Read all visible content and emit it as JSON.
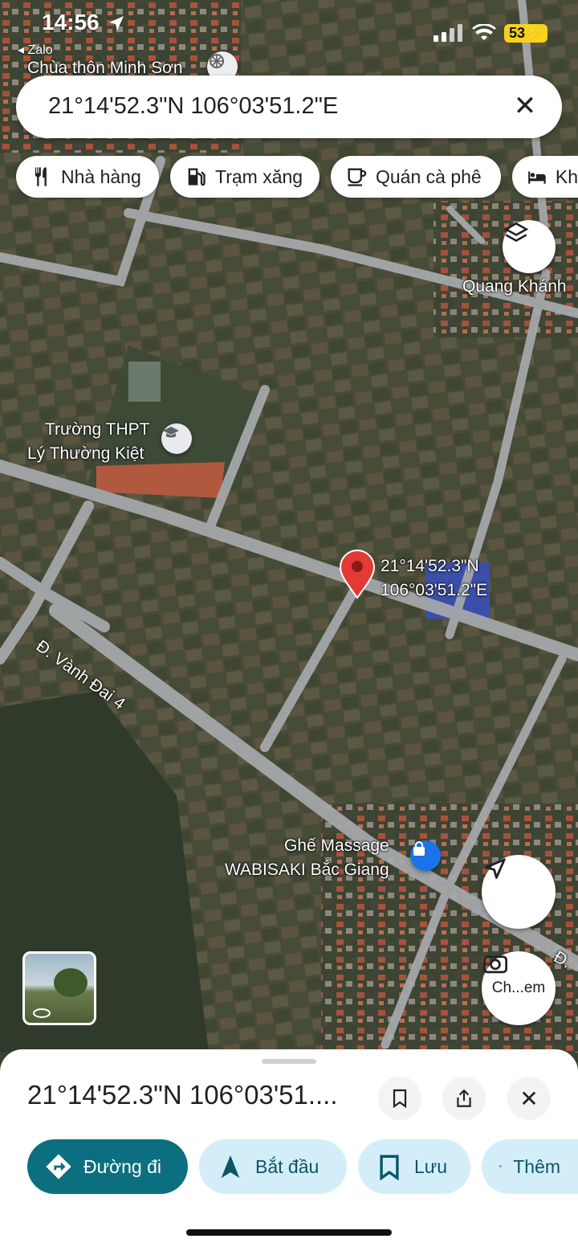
{
  "status_bar": {
    "time": "14:56",
    "back_app": "◂ Zalo",
    "battery": "53"
  },
  "search": {
    "value": "21°14'52.3\"N 106°03'51.2\"E"
  },
  "chips": [
    {
      "label": "Nhà hàng",
      "icon": "restaurant-icon"
    },
    {
      "label": "Trạm xăng",
      "icon": "gas-station-icon"
    },
    {
      "label": "Quán cà phê",
      "icon": "coffee-icon"
    },
    {
      "label": "Kh",
      "icon": "hotel-icon"
    }
  ],
  "map": {
    "labels": {
      "chua": "Chùa thôn Minh Sơn",
      "quang_khanh": "Quang Khánh",
      "school_1": "Trường THPT",
      "school_2": "Lý Thường Kiệt",
      "pin_1": "21°14'52.3\"N",
      "pin_2": "106°03'51.2\"E",
      "road": "Đ. Vành Đai 4",
      "massage_1": "Ghế Massage",
      "massage_2": "WABISAKI Bắc Giang",
      "road_right": "Đ."
    },
    "lens_label": "Ch...em",
    "colors": {
      "pin": "#e53935",
      "accent": "#0b7a8c"
    }
  },
  "sheet": {
    "title": "21°14'52.3\"N 106°03'51....",
    "actions": [
      {
        "label": "Đường đi",
        "icon": "directions-icon"
      },
      {
        "label": "Bắt đầu",
        "icon": "navigation-arrow-icon"
      },
      {
        "label": "Lưu",
        "icon": "bookmark-icon"
      },
      {
        "label": "Thêm",
        "icon": "flag-icon"
      }
    ]
  }
}
